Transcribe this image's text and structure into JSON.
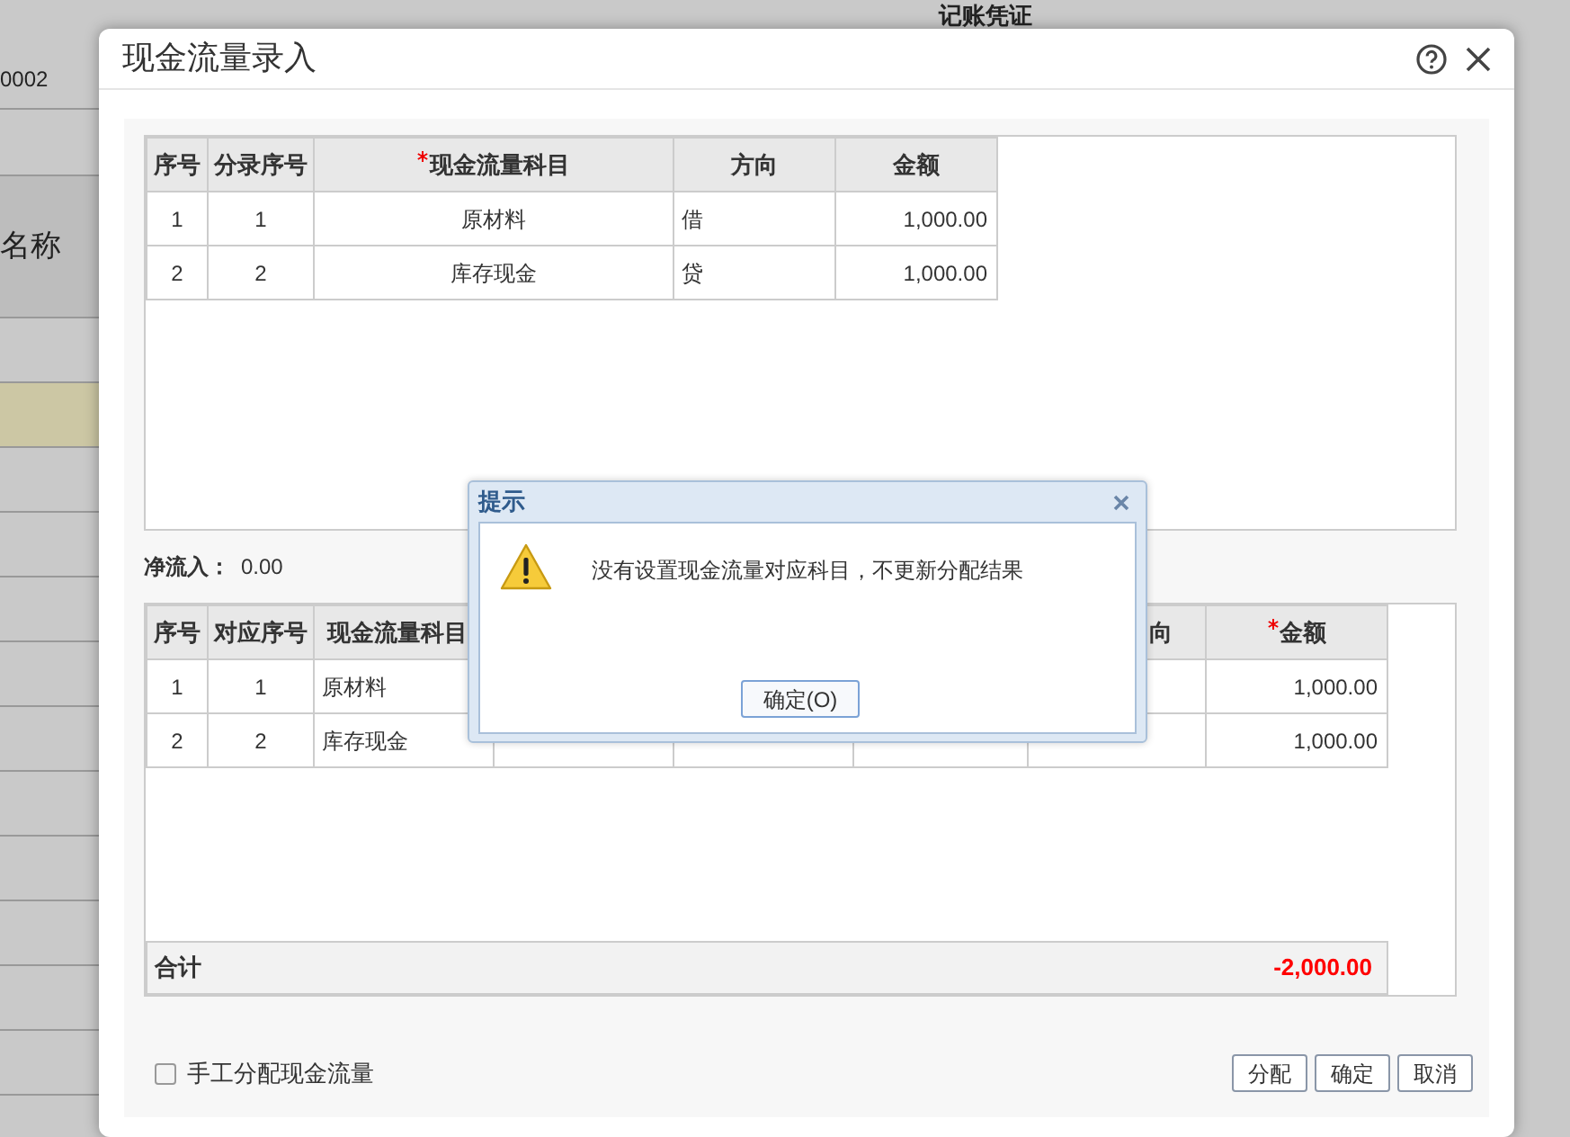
{
  "background": {
    "title": "记账凭证",
    "number": "0002",
    "column_label": "名称"
  },
  "window": {
    "title": "现金流量录入"
  },
  "upper_table": {
    "columns": [
      {
        "label": "序号",
        "required": false
      },
      {
        "label": "分录序号",
        "required": false
      },
      {
        "label": "现金流量科目",
        "required": true
      },
      {
        "label": "方向",
        "required": false
      },
      {
        "label": "金额",
        "required": false
      }
    ],
    "rows": [
      [
        "1",
        "1",
        "原材料",
        "借",
        "1,000.00"
      ],
      [
        "2",
        "2",
        "库存现金",
        "贷",
        "1,000.00"
      ]
    ]
  },
  "net_inflow": {
    "label": "净流入：",
    "value": "0.00"
  },
  "lower_table": {
    "columns": [
      {
        "label": "序号",
        "required": false
      },
      {
        "label": "对应序号",
        "required": false
      },
      {
        "label": "现金流量科目",
        "required": false
      },
      {
        "label": "向",
        "required": false
      },
      {
        "label": "金额",
        "required": true
      }
    ],
    "rows": [
      {
        "column_1": "1",
        "column_2": "1",
        "column_3": "原材料",
        "amount": "1,000.00"
      },
      {
        "column_1": "2",
        "column_2": "2",
        "column_3": "库存现金",
        "amount": "1,000.00"
      }
    ],
    "total": {
      "label": "合计",
      "value": "-2,000.00"
    }
  },
  "manual_checkbox": {
    "label": "手工分配现金流量",
    "checked": false
  },
  "buttons": [
    "分配",
    "确定",
    "取消"
  ],
  "alert": {
    "title": "提示",
    "message": "没有设置现金流量对应科目，不更新分配结果",
    "button": "确定(O)"
  }
}
